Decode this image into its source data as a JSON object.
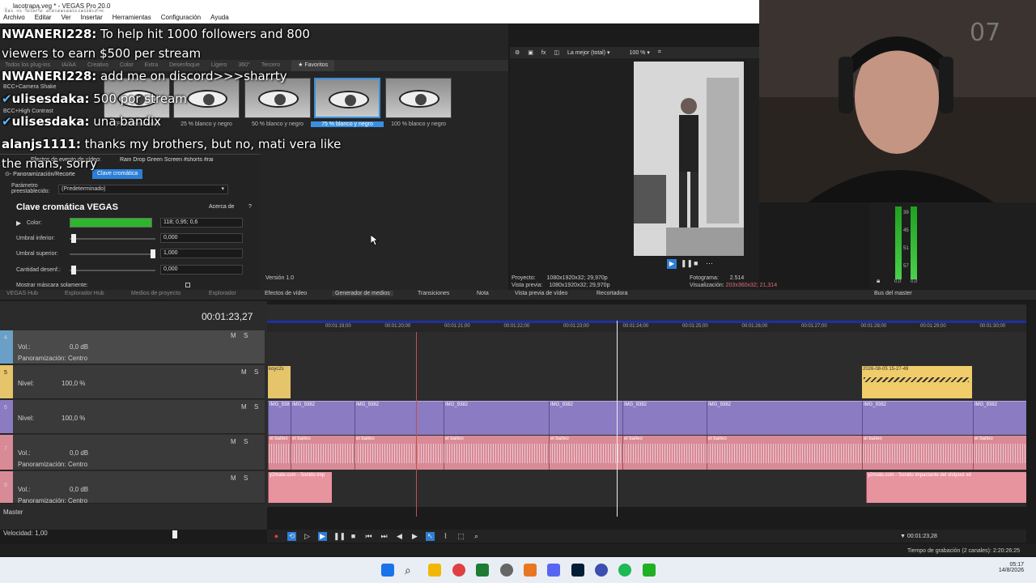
{
  "window": {
    "title": "lacotrapa.veg * - VEGAS Pro 20.0",
    "overlay_title": "In a kick community's"
  },
  "menu": [
    "Archivo",
    "Editar",
    "Ver",
    "Insertar",
    "Herramientas",
    "Configuración",
    "Ayuda"
  ],
  "chat": [
    {
      "user": "NWANERI228:",
      "text": " To help hit 1000 followers and 800"
    },
    {
      "user": "",
      "text": "viewers to earn $500 per stream"
    },
    {
      "user": "NWANERI228:",
      "text": " add me on discord>>>sharrty"
    },
    {
      "user": "ulisesdaka:",
      "text": " 500 por stream"
    },
    {
      "user": "ulisesdaka:",
      "text": " una bandix"
    },
    {
      "user": "alanjs1111:",
      "text": " thanks my brothers, but no, mati vera like"
    },
    {
      "user": "",
      "text": "the mans, sorry"
    }
  ],
  "plugin_tabs": [
    "Todos los plug-ins",
    "IA/AA",
    "Creativo",
    "Color",
    "Extra",
    "Desenfoque",
    "Ligero",
    "360°",
    "Tercero",
    "Favoritos"
  ],
  "plugin_list": [
    "BCC+Camera Shake",
    "BCC+High Contrast"
  ],
  "presets": [
    {
      "label": "(Predeterminado)"
    },
    {
      "label": "25 % blanco y negro"
    },
    {
      "label": "50 % blanco y negro"
    },
    {
      "label": "75 % blanco y negro"
    },
    {
      "label": "100 % blanco y negro"
    }
  ],
  "fx": {
    "header": "Efectos de evento de vídeo:",
    "event_name": "Rain Drop Green Screen #shorts #rai",
    "chain": [
      "Panoramización/Recorte",
      "Clave cromática"
    ],
    "preset_label": "Parámetro preestablecido:",
    "preset_value": "(Predeterminado)",
    "plugin_title": "Clave cromática VEGAS",
    "about": "Acerca de",
    "help": "?",
    "color_label": "Color:",
    "color_value": "118; 0,95; 0,6",
    "low_label": "Umbral inferior:",
    "low_value": "0,000",
    "high_label": "Umbral superior:",
    "high_value": "1,000",
    "blur_label": "Cantidad desenf.:",
    "blur_value": "0,000",
    "mask_label": "Mostrar máscara solamente:",
    "version": "Versión 1.0",
    "key_color": "#2db52d"
  },
  "preview": {
    "quality": "La mejor (total)",
    "zoom": "100 %",
    "project_label": "Proyecto:",
    "project_value": "1080x1920x32; 29,970p",
    "preview_label": "Vista previa:",
    "preview_value": "1080x1920x32; 29,970p",
    "frame_label": "Fotograma:",
    "frame_value": "2.514",
    "display_label": "Visualización:",
    "display_value": "203x360x32; 21,314"
  },
  "bottom_tabs": [
    "Efectos de vídeo",
    "Generador de medios",
    "Transiciones",
    "Nota",
    "Vista previa de vídeo",
    "Recortadora",
    "Bus del master"
  ],
  "left_tabs": [
    "VEGAS Hub",
    "Explorador Hub",
    "Medios de proyecto",
    "Explorador"
  ],
  "meter_labels": [
    "39",
    "45",
    "51",
    "57",
    "0,0",
    "0,0"
  ],
  "timecode": "00:01:23,27",
  "ruler_ticks": [
    "00:01:19;00",
    "00:01:20;00",
    "00:01:21;00",
    "00:01:22;00",
    "00:01:23;00",
    "00:01:24;00",
    "00:01:25;00",
    "00:01:26;00",
    "00:01:27;00",
    "00:01:28;00",
    "00:01:29;00",
    "00:01:30;00"
  ],
  "tracks": [
    {
      "num": "4",
      "vol_label": "Vol.:",
      "vol": "0,0 dB",
      "pan_label": "Panoramización:",
      "pan": "Centro",
      "color": "#6aa0c8"
    },
    {
      "num": "5",
      "level_label": "Nivel:",
      "level": "100,0 %",
      "color": "#e5c46a"
    },
    {
      "num": "6",
      "level_label": "Nivel:",
      "level": "100,0 %",
      "color": "#8a7bc2"
    },
    {
      "num": "7",
      "vol_label": "Vol.:",
      "vol": "0,0 dB",
      "pan_label": "Panoramización:",
      "pan": "Centro",
      "color": "#d98a97"
    },
    {
      "num": "8",
      "vol_label": "Vol.:",
      "vol": "0,0 dB",
      "pan_label": "Panoramización:",
      "pan": "Centro",
      "color": "#d98a97"
    }
  ],
  "clips": {
    "yellow_left": "koyc2s",
    "yellow_right": "2026-08-05 15-27-49",
    "video": [
      "IMG_938",
      "IMG_9382",
      "IMG_9382",
      "IMG_9382",
      "IMG_9382",
      "IMG_9382",
      "IMG_9382",
      "IMG_9382",
      "IMG_9382",
      "IMG_9382"
    ],
    "audio": "el baiteo",
    "sfx_left": "y2mate.com - Sonido imp",
    "sfx_right": "y2mate.com - Sonido impactante del shitpost xd"
  },
  "master_label": "Master",
  "speed": "Velocidad: 1,00",
  "transport_time": "00:01:23,28",
  "status": "Tiempo de grabación (2 canales): 2:20:26:25",
  "clock": {
    "time": "05:17",
    "date": "14/8/2026"
  }
}
